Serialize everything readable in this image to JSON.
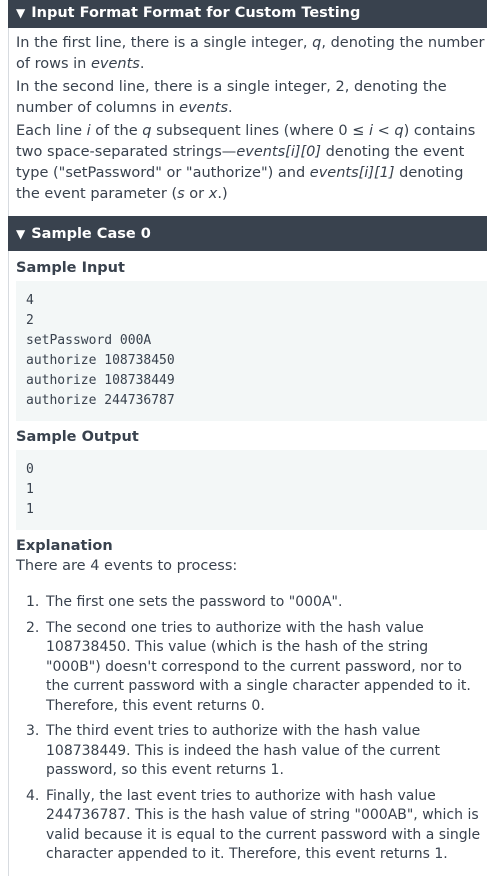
{
  "input_section": {
    "title": "Input Format Format for Custom Testing",
    "line1": {
      "pre": "In the first line, there is a single integer, ",
      "var": "q",
      "mid": ", denoting the number of rows in ",
      "arr": "events",
      "end": "."
    },
    "line2": {
      "pre": "In the second line, there is a single integer, 2, denoting the number of columns in ",
      "arr": "events",
      "end": "."
    },
    "line3": {
      "a": "Each line ",
      "i": "i",
      "b": " of the ",
      "q": "q",
      "c": " subsequent lines (where 0 ",
      "le": "≤ i < q",
      "d": ") contains two space-separated strings—",
      "e0": "events[i][0]",
      "e": " denoting the event type (\"setPassword\" or \"authorize\") and ",
      "e1": "events[i][1]",
      "f": " denoting the event parameter (",
      "s": "s",
      "g": " or ",
      "x": "x",
      "h": ".)"
    }
  },
  "sample_case": {
    "title": "Sample Case 0",
    "input_label": "Sample Input",
    "input_text": "4\n2\nsetPassword 000A\nauthorize 108738450\nauthorize 108738449\nauthorize 244736787",
    "output_label": "Sample Output",
    "output_text": "0\n1\n1",
    "explanation_label": "Explanation",
    "explanation_intro": "There are 4 events to process:",
    "steps": [
      {
        "num": "1.",
        "text": "The first one sets the password to \"000A\"."
      },
      {
        "num": "2.",
        "text": "The second one tries to authorize with the hash value 108738450. This value (which is the hash of the string \"000B\") doesn't correspond to the current password, nor to the current password with a single character appended to it. Therefore, this event returns 0."
      },
      {
        "num": "3.",
        "text": "The third event tries to authorize with the hash value 108738449. This is indeed the hash value of the current password, so this event returns 1."
      },
      {
        "num": "4.",
        "text": "Finally, the last event tries to authorize with hash value 244736787. This is the hash value of string \"000AB\", which is valid because it is equal to the current password with a single character appended to it. Therefore, this event returns 1."
      }
    ]
  }
}
